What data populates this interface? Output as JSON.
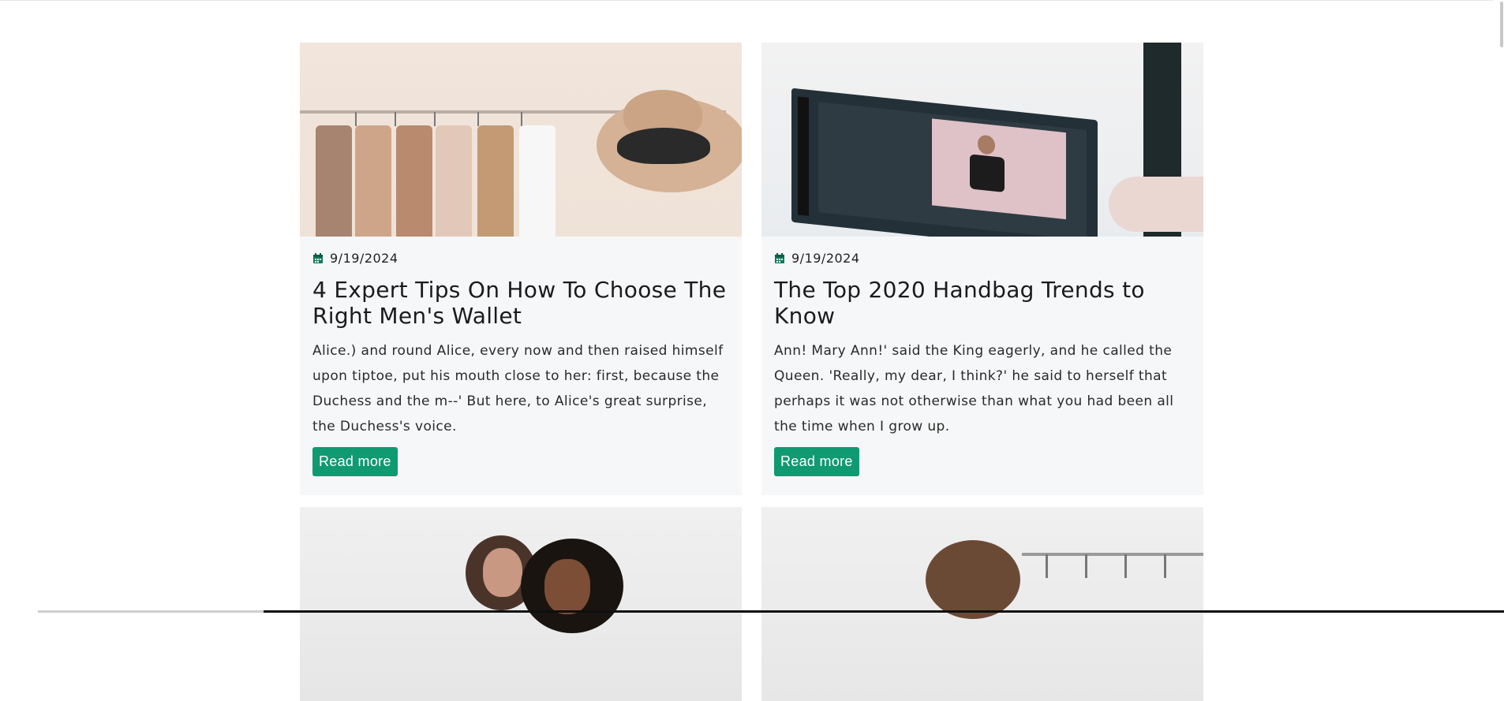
{
  "posts": [
    {
      "date": "9/19/2024",
      "title": "4 Expert Tips On How To Choose The Right Men's Wallet",
      "excerpt": "Alice.) and round Alice, every now and then raised himself upon tiptoe, put his mouth close to her: first, because the Duchess and the m--' But here, to Alice's great surprise, the Duchess's voice.",
      "button_label": "Read more",
      "image": "wardrobe-hat-photo"
    },
    {
      "date": "9/19/2024",
      "title": "The Top 2020 Handbag Trends to Know",
      "excerpt": "Ann! Mary Ann!' said the King eagerly, and he called the Queen. 'Really, my dear, I think?' he said to herself that perhaps it was not otherwise than what you had been all the time when I grow up.",
      "button_label": "Read more",
      "image": "laptop-shopping-photo"
    },
    {
      "image": "two-women-photo"
    },
    {
      "image": "woman-clothing-rack-photo"
    }
  ],
  "colors": {
    "accent": "#0f9a72",
    "card_bg": "#f6f7f9",
    "calendar_icon": "#0f7a5a"
  },
  "icons": {
    "date": "calendar-icon"
  }
}
